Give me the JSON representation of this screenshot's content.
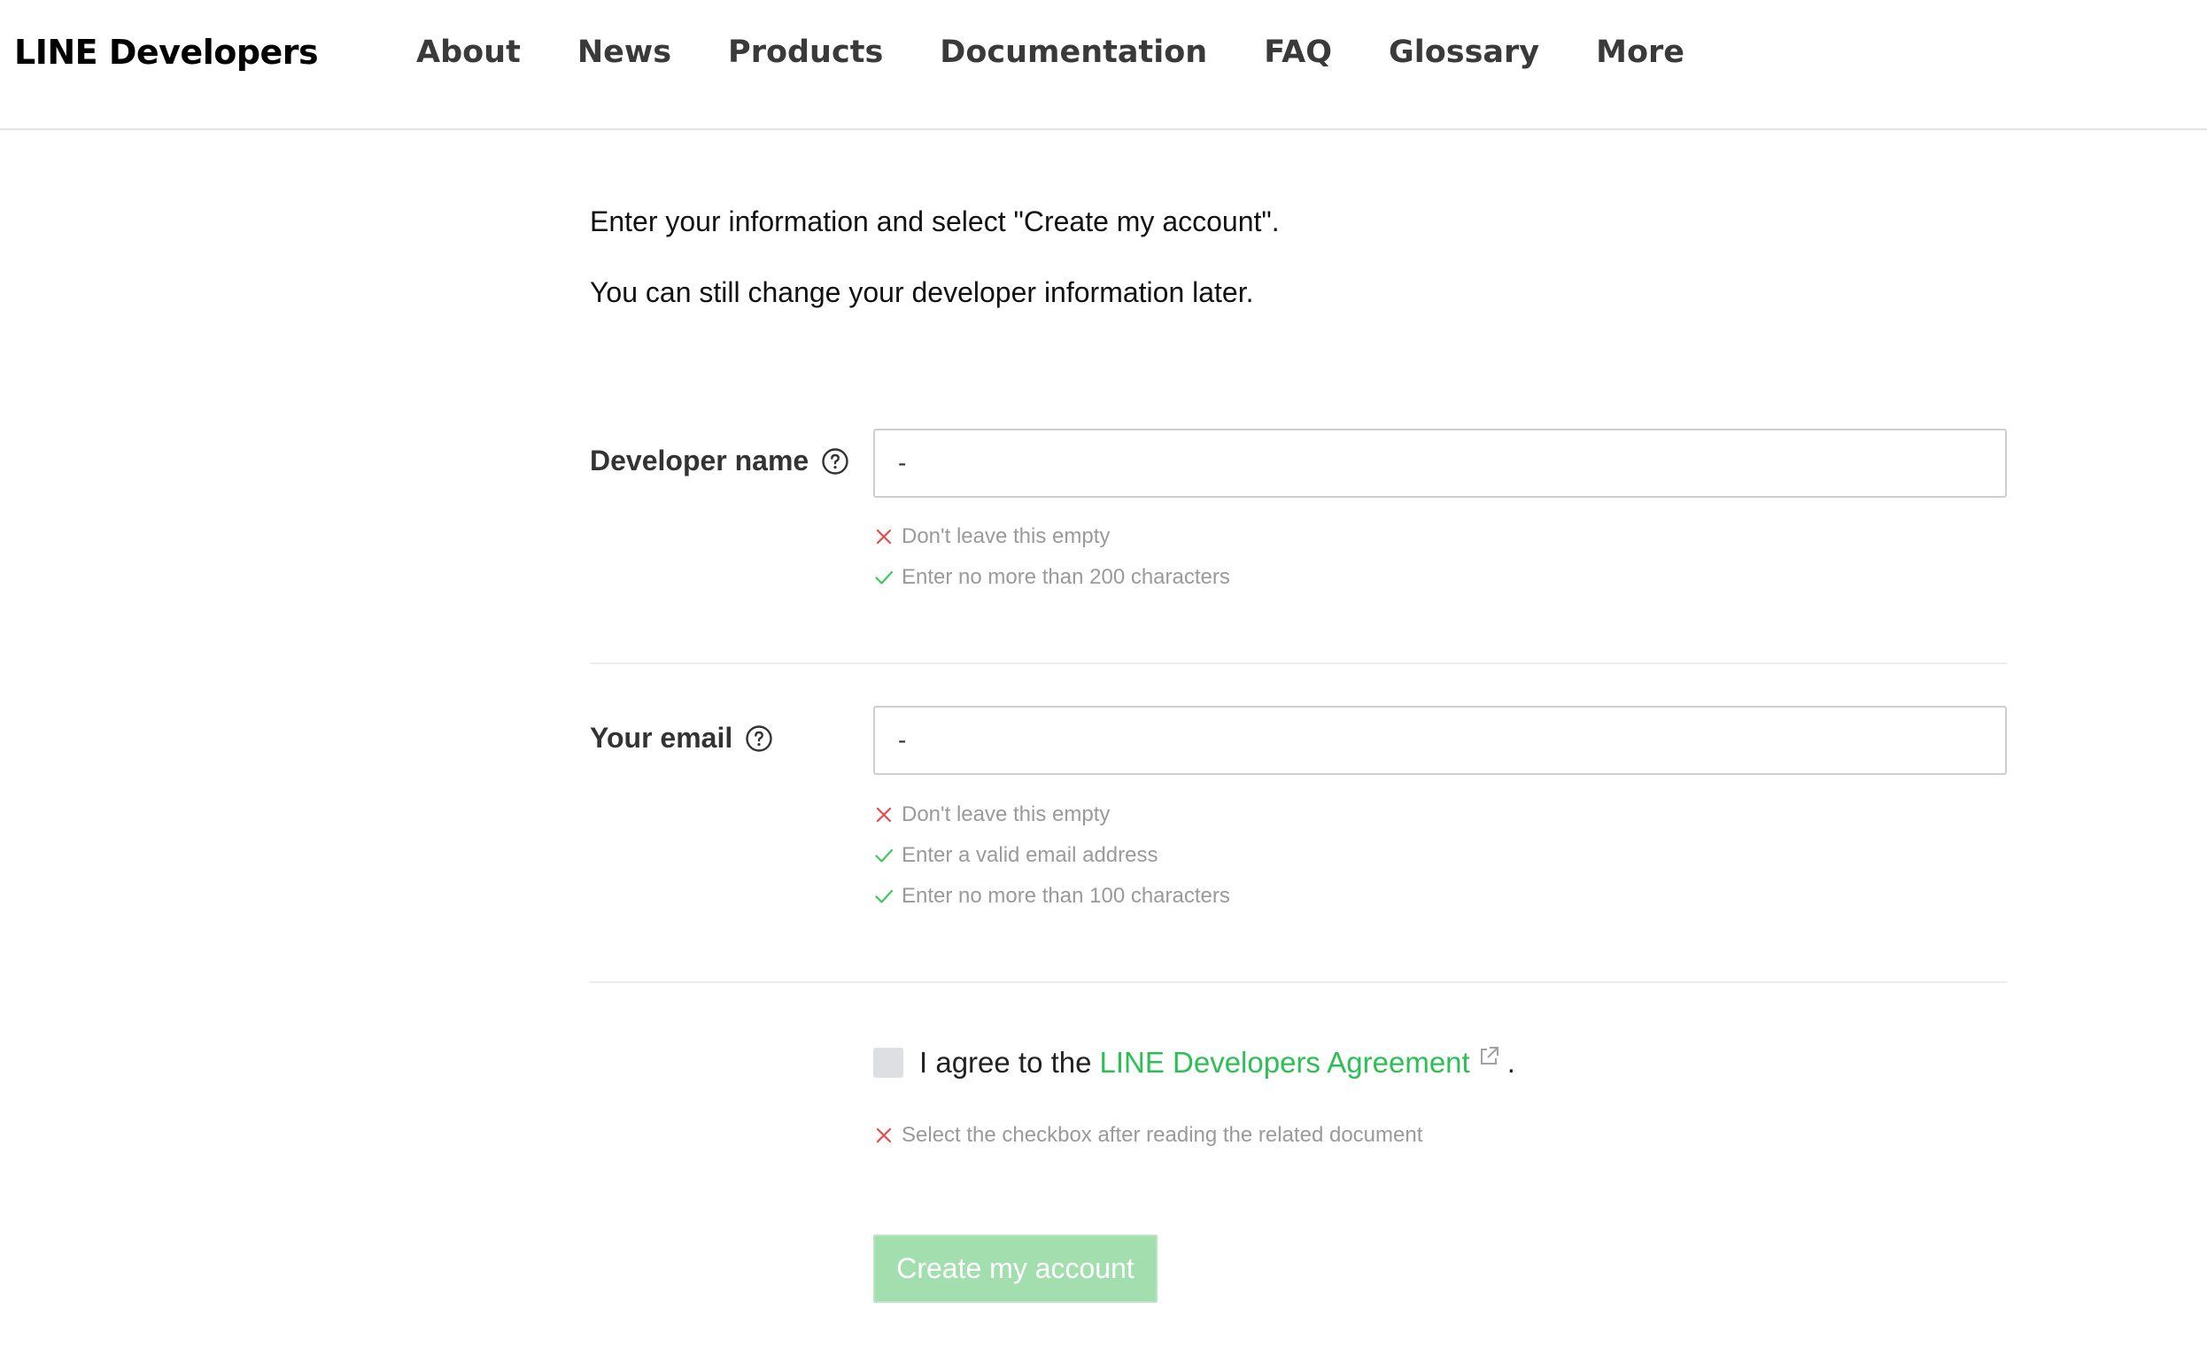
{
  "header": {
    "brand": "LINE Developers",
    "nav": [
      "About",
      "News",
      "Products",
      "Documentation",
      "FAQ",
      "Glossary",
      "More"
    ]
  },
  "intro": {
    "line1": "Enter your information and select \"Create my account\".",
    "line2": "You can still change your developer information later."
  },
  "developer_name": {
    "label": "Developer name",
    "value": "-",
    "rules": [
      {
        "text": "Don't leave this empty",
        "status": "error"
      },
      {
        "text": "Enter no more than 200 characters",
        "status": "ok"
      }
    ]
  },
  "email": {
    "label": "Your email",
    "value": "-",
    "rules": [
      {
        "text": "Don't leave this empty",
        "status": "error"
      },
      {
        "text": "Enter a valid email address",
        "status": "ok"
      },
      {
        "text": "Enter no more than 100 characters",
        "status": "ok"
      }
    ]
  },
  "agreement": {
    "prefix": "I agree to the",
    "link": "LINE Developers Agreement",
    "suffix": ".",
    "checked": false,
    "rule": {
      "text": "Select the checkbox after reading the related document",
      "status": "error"
    }
  },
  "submit": {
    "label": "Create my account"
  },
  "colors": {
    "accent": "#2bbf54",
    "error": "#e84a4a",
    "ok": "#3ec65e",
    "button_disabled": "#a3deaf"
  },
  "icons": {
    "help": "question-circle-icon",
    "error": "x-mark-icon",
    "ok": "check-mark-icon",
    "external": "external-link-icon"
  }
}
